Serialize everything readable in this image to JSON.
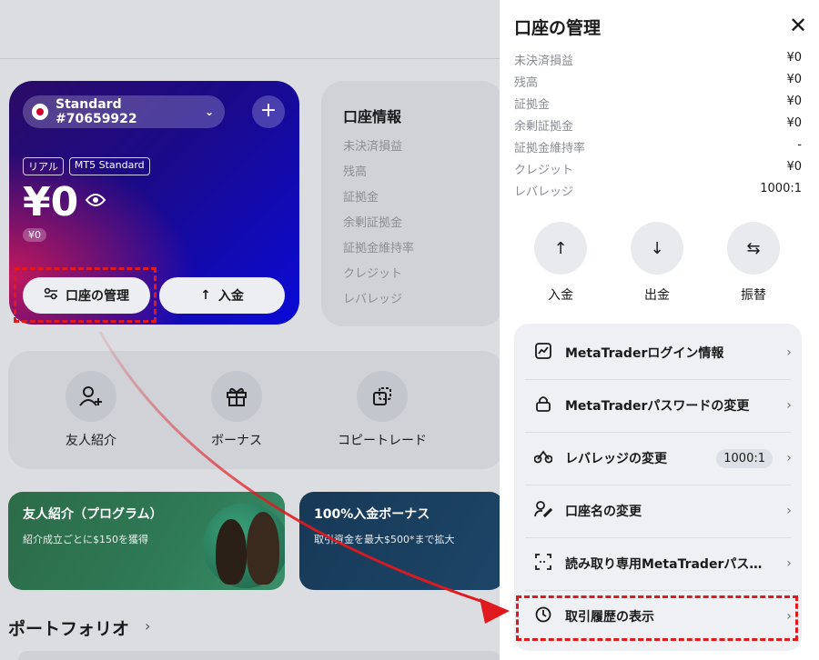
{
  "account_card": {
    "account_name": "Standard #70659922",
    "tags": [
      "リアル",
      "MT5 Standard"
    ],
    "balance": "¥0",
    "sub_balance": "¥0",
    "manage_label": "口座の管理",
    "deposit_label": "入金"
  },
  "info_card": {
    "title": "口座情報",
    "items": [
      "未決済損益",
      "残高",
      "証拠金",
      "余剰証拠金",
      "証拠金維持率",
      "クレジット",
      "レバレッジ"
    ]
  },
  "quick_actions": {
    "referral": "友人紹介",
    "bonus": "ボーナス",
    "copy_trade": "コピートレード"
  },
  "promos": {
    "referral_title": "友人紹介（プログラム）",
    "referral_sub": "紹介成立ごとに$150を獲得",
    "bonus_title": "100%入金ボーナス",
    "bonus_sub": "取引資金を最大$500*まで拡大"
  },
  "portfolio_label": "ポートフォリオ",
  "drawer": {
    "title": "口座の管理",
    "rows": [
      {
        "label": "未決済損益",
        "value": "¥0"
      },
      {
        "label": "残高",
        "value": "¥0"
      },
      {
        "label": "証拠金",
        "value": "¥0"
      },
      {
        "label": "余剰証拠金",
        "value": "¥0"
      },
      {
        "label": "証拠金維持率",
        "value": "-"
      },
      {
        "label": "クレジット",
        "value": "¥0"
      },
      {
        "label": "レバレッジ",
        "value": "1000:1"
      }
    ],
    "actions": {
      "deposit": "入金",
      "withdraw": "出金",
      "transfer": "振替"
    },
    "menu": [
      {
        "label": "MetaTraderログイン情報"
      },
      {
        "label": "MetaTraderパスワードの変更"
      },
      {
        "label": "レバレッジの変更",
        "badge": "1000:1"
      },
      {
        "label": "口座名の変更"
      },
      {
        "label": "読み取り専用MetaTraderパスワード"
      },
      {
        "label": "取引履歴の表示"
      }
    ]
  },
  "colors": {
    "highlight": "#e0191e",
    "card_gradient_start": "#2a0b66",
    "card_gradient_end": "#0a0ad8"
  }
}
